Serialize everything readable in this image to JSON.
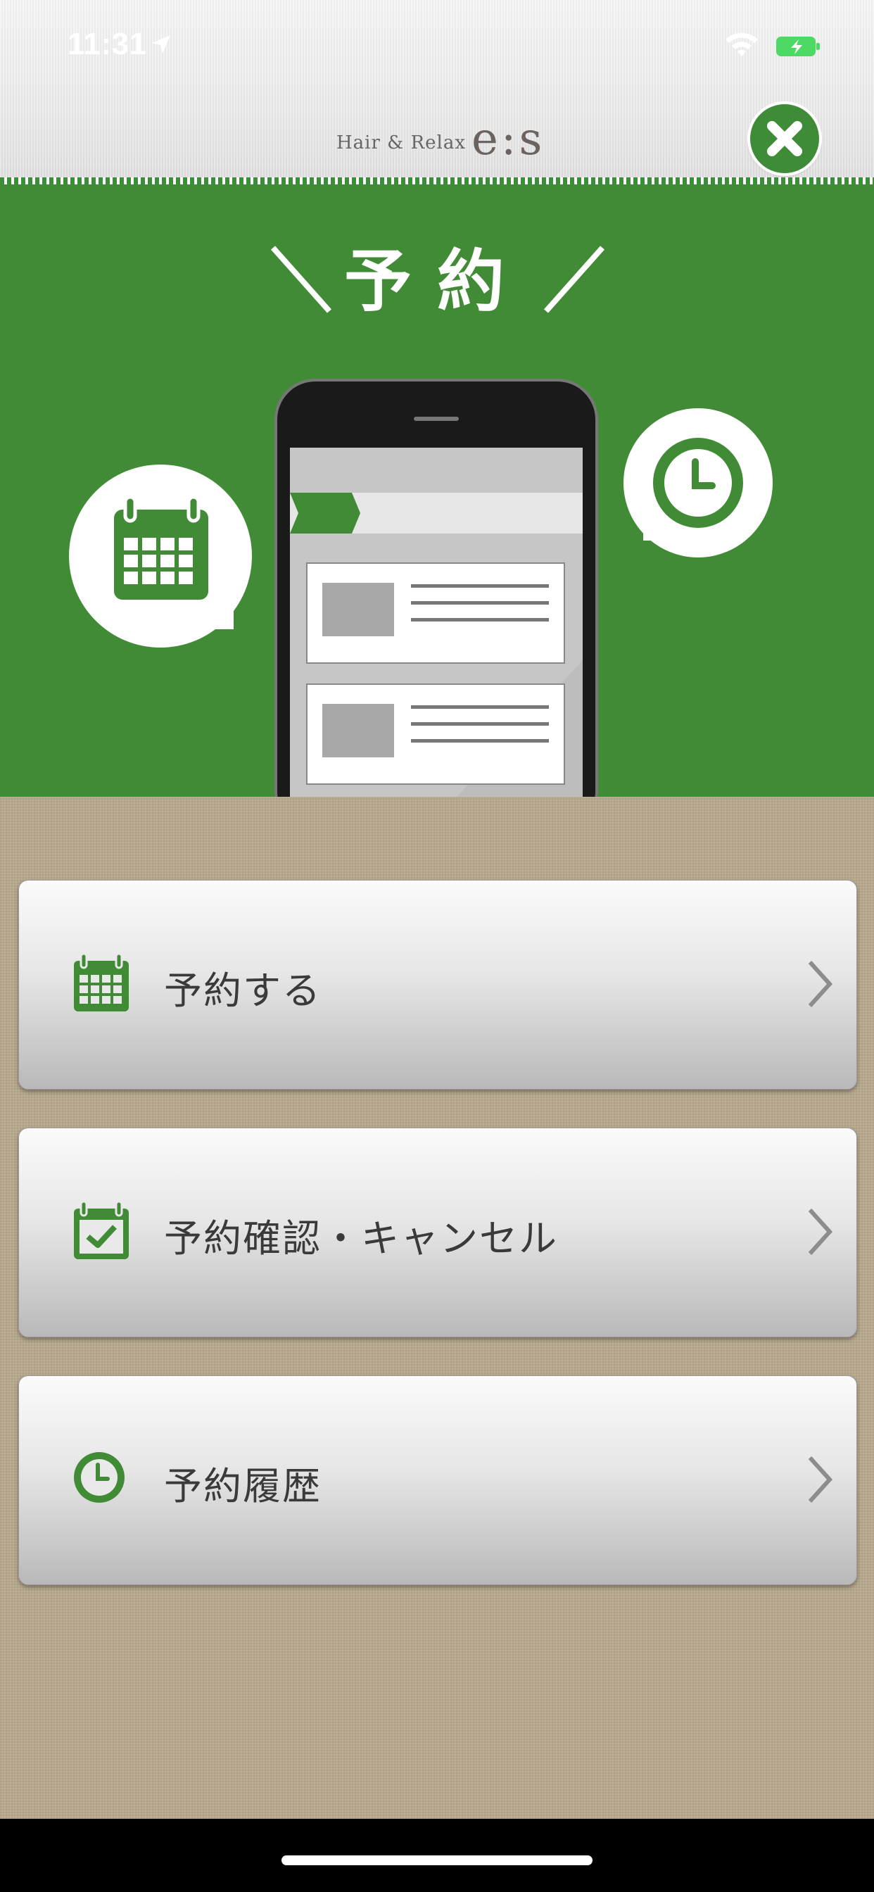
{
  "status_bar": {
    "time": "11:31",
    "icons": [
      "location-arrow-icon",
      "wifi-icon",
      "battery-charging-icon"
    ]
  },
  "header": {
    "logo_small": "Hair & Relax",
    "logo_big": "e:s",
    "close_icon": "close-icon"
  },
  "hero": {
    "title": "予約",
    "illustration": [
      "calendar-bubble-icon",
      "smartphone-illustration",
      "clock-bubble-icon"
    ]
  },
  "menu": {
    "items": [
      {
        "label": "予約する",
        "icon": "calendar-icon"
      },
      {
        "label": "予約確認・キャンセル",
        "icon": "calendar-check-icon"
      },
      {
        "label": "予約履歴",
        "icon": "clock-icon"
      }
    ]
  },
  "colors": {
    "brand_green": "#418b37",
    "background_linen": "#b9aa8e",
    "button_text": "#3a3a3a"
  }
}
